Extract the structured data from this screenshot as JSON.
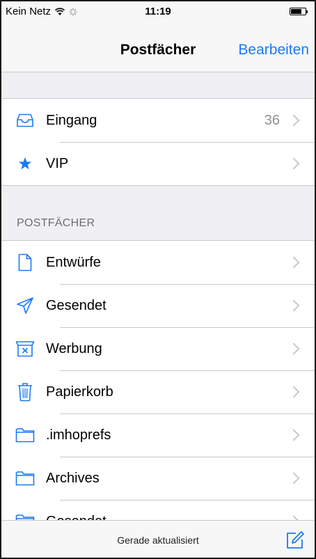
{
  "statusbar": {
    "carrier": "Kein Netz",
    "time": "11:19"
  },
  "navbar": {
    "title": "Postfächer",
    "edit_label": "Bearbeiten"
  },
  "top_mailboxes": [
    {
      "label": "Eingang",
      "count": "36",
      "icon": "inbox-icon"
    },
    {
      "label": "VIP",
      "count": "",
      "icon": "star-icon"
    }
  ],
  "section_header": "POSTFÄCHER",
  "mailboxes": [
    {
      "label": "Entwürfe",
      "icon": "document-icon"
    },
    {
      "label": "Gesendet",
      "icon": "paper-plane-icon"
    },
    {
      "label": "Werbung",
      "icon": "junk-icon"
    },
    {
      "label": "Papierkorb",
      "icon": "trash-icon"
    },
    {
      "label": ".imhoprefs",
      "icon": "folder-icon"
    },
    {
      "label": "Archives",
      "icon": "folder-icon"
    },
    {
      "label": "Gesendet",
      "icon": "folder-icon"
    }
  ],
  "toolbar": {
    "status": "Gerade aktualisiert",
    "compose_icon": "compose-icon"
  },
  "colors": {
    "accent": "#1a7af8",
    "background": "#efeff4",
    "separator": "#c8c7cc"
  }
}
